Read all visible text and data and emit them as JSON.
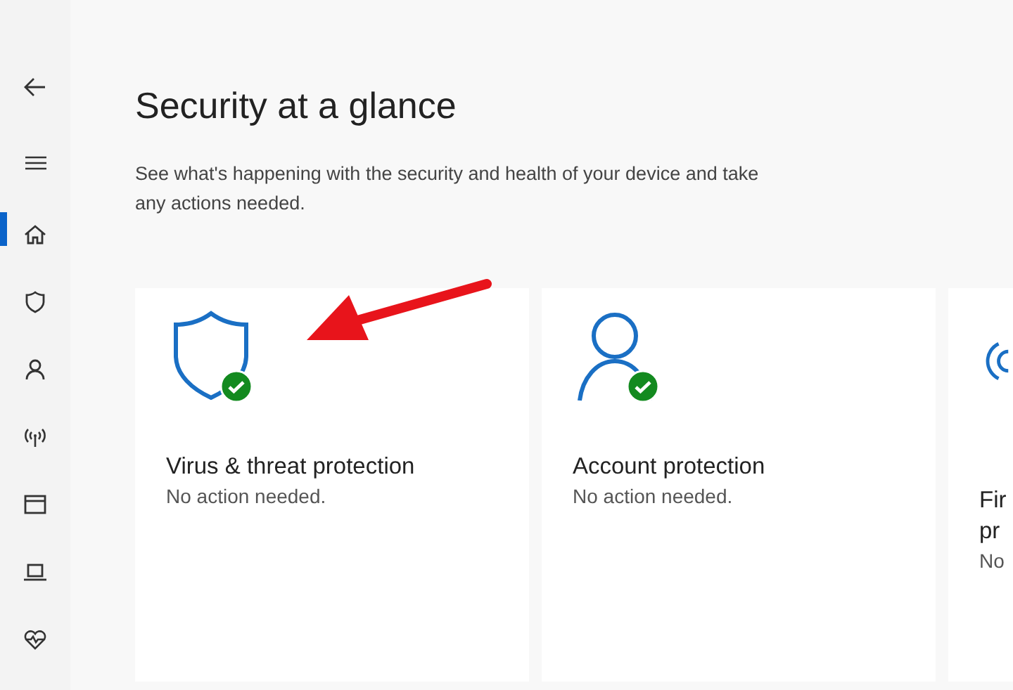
{
  "sidebar": {
    "top": [
      {
        "kind": "back"
      },
      {
        "kind": "menu"
      }
    ],
    "items": [
      {
        "kind": "home",
        "selected": true
      },
      {
        "kind": "shield",
        "selected": false
      },
      {
        "kind": "person",
        "selected": false
      },
      {
        "kind": "antenna",
        "selected": false
      },
      {
        "kind": "window",
        "selected": false
      },
      {
        "kind": "laptop",
        "selected": false
      },
      {
        "kind": "heart",
        "selected": false
      }
    ]
  },
  "page": {
    "title": "Security at a glance",
    "description": "See what's happening with the security and health of your device and take any actions needed."
  },
  "cards": [
    {
      "kind": "shield",
      "ok": true,
      "title": [
        "Virus & threat protection"
      ],
      "status": "No action needed."
    },
    {
      "kind": "person",
      "ok": true,
      "title": [
        "Account protection"
      ],
      "status": "No action needed."
    },
    {
      "kind": "wifi",
      "title": [
        "Fir",
        "pr"
      ],
      "status": "No"
    }
  ],
  "annotation": {
    "kind": "arrow"
  }
}
